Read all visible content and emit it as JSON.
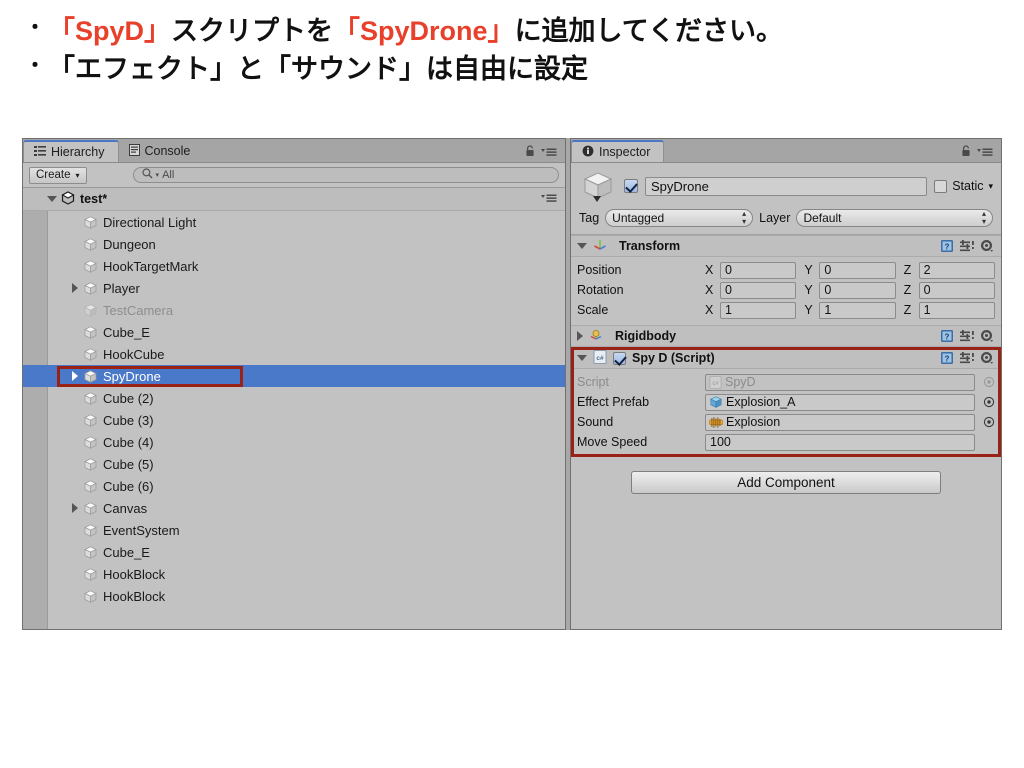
{
  "slide": {
    "bullets": [
      {
        "dot": "・",
        "segments": [
          {
            "text": "「SpyD」",
            "highlight": true
          },
          {
            "text": "スクリプトを",
            "highlight": false
          },
          {
            "text": "「SpyDrone」",
            "highlight": true
          },
          {
            "text": "に追加してください。",
            "highlight": false
          }
        ]
      },
      {
        "dot": "・",
        "segments": [
          {
            "text": "「エフェクト」と「サウンド」は自由に設定",
            "highlight": false
          }
        ]
      }
    ]
  },
  "colors": {
    "highlight_red": "#e8402a",
    "outline_red": "#9a2116",
    "selection_blue": "#4b79c9",
    "tab_accent": "#4b77c4",
    "panel_bg": "#c2c2c2"
  },
  "hierarchy": {
    "tabs": [
      {
        "label": "Hierarchy",
        "icon": "hierarchy-icon",
        "active": true
      },
      {
        "label": "Console",
        "icon": "console-icon",
        "active": false
      }
    ],
    "lock_icon": "lock-icon",
    "menu_icon": "panel-menu-icon",
    "toolbar": {
      "create_label": "Create",
      "create_arrow": "▾",
      "search_placeholder": "All",
      "search_value": "",
      "search_icon": "search-icon"
    },
    "scene": {
      "name": "test*",
      "icon": "unity-scene-icon",
      "expanded": true
    },
    "items": [
      {
        "label": "Directional Light",
        "indent": 1,
        "expandable": false,
        "active": true,
        "selected": false
      },
      {
        "label": "Dungeon",
        "indent": 1,
        "expandable": false,
        "active": true,
        "selected": false
      },
      {
        "label": "HookTargetMark",
        "indent": 1,
        "expandable": false,
        "active": true,
        "selected": false
      },
      {
        "label": "Player",
        "indent": 1,
        "expandable": true,
        "active": true,
        "selected": false
      },
      {
        "label": "TestCamera",
        "indent": 1,
        "expandable": false,
        "active": false,
        "selected": false
      },
      {
        "label": "Cube_E",
        "indent": 1,
        "expandable": false,
        "active": true,
        "selected": false
      },
      {
        "label": "HookCube",
        "indent": 1,
        "expandable": false,
        "active": true,
        "selected": false
      },
      {
        "label": "SpyDrone",
        "indent": 1,
        "expandable": true,
        "active": true,
        "selected": true
      },
      {
        "label": "Cube (2)",
        "indent": 1,
        "expandable": false,
        "active": true,
        "selected": false
      },
      {
        "label": "Cube (3)",
        "indent": 1,
        "expandable": false,
        "active": true,
        "selected": false
      },
      {
        "label": "Cube (4)",
        "indent": 1,
        "expandable": false,
        "active": true,
        "selected": false
      },
      {
        "label": "Cube (5)",
        "indent": 1,
        "expandable": false,
        "active": true,
        "selected": false
      },
      {
        "label": "Cube (6)",
        "indent": 1,
        "expandable": false,
        "active": true,
        "selected": false
      },
      {
        "label": "Canvas",
        "indent": 1,
        "expandable": true,
        "active": true,
        "selected": false
      },
      {
        "label": "EventSystem",
        "indent": 1,
        "expandable": false,
        "active": true,
        "selected": false
      },
      {
        "label": "Cube_E",
        "indent": 1,
        "expandable": false,
        "active": true,
        "selected": false
      },
      {
        "label": "HookBlock",
        "indent": 1,
        "expandable": false,
        "active": true,
        "selected": false
      },
      {
        "label": "HookBlock",
        "indent": 1,
        "expandable": false,
        "active": true,
        "selected": false
      }
    ]
  },
  "inspector": {
    "tab": {
      "label": "Inspector",
      "icon": "info-icon"
    },
    "lock_icon": "lock-icon",
    "menu_icon": "panel-menu-icon",
    "object": {
      "enabled": true,
      "name": "SpyDrone",
      "static_label": "Static",
      "static_checked": false,
      "static_arrow": "▾",
      "tag_label": "Tag",
      "tag_value": "Untagged",
      "layer_label": "Layer",
      "layer_value": "Default",
      "preview_icon": "gameobject-cube-icon"
    },
    "components": [
      {
        "name": "Transform",
        "icon": "transform-icon",
        "expanded": true,
        "has_checkbox": false,
        "help_icon": "help-book-icon",
        "preset_icon": "preset-icon",
        "gear_icon": "gear-icon",
        "vector_rows": [
          {
            "label": "Position",
            "x": "0",
            "y": "0",
            "z": "2"
          },
          {
            "label": "Rotation",
            "x": "0",
            "y": "0",
            "z": "0"
          },
          {
            "label": "Scale",
            "x": "1",
            "y": "1",
            "z": "1"
          }
        ],
        "axis_labels": [
          "X",
          "Y",
          "Z"
        ]
      },
      {
        "name": "Rigidbody",
        "icon": "rigidbody-icon",
        "expanded": false,
        "has_checkbox": false,
        "help_icon": "help-book-icon",
        "preset_icon": "preset-icon",
        "gear_icon": "gear-icon"
      }
    ],
    "script_component": {
      "name": "Spy D (Script)",
      "icon": "csharp-script-icon",
      "expanded": true,
      "enabled": true,
      "help_icon": "help-book-icon",
      "preset_icon": "preset-icon",
      "gear_icon": "gear-icon",
      "highlighted": true,
      "fields": [
        {
          "label": "Script",
          "value": "SpyD",
          "icon": "csharp-script-icon",
          "type": "object",
          "disabled": true,
          "picker": true
        },
        {
          "label": "Effect Prefab",
          "value": "Explosion_A",
          "icon": "prefab-cube-icon",
          "type": "object",
          "disabled": false,
          "picker": true
        },
        {
          "label": "Sound",
          "value": "Explosion",
          "icon": "audioclip-icon",
          "type": "object",
          "disabled": false,
          "picker": true
        },
        {
          "label": "Move Speed",
          "value": "100",
          "icon": "",
          "type": "number",
          "disabled": false,
          "picker": false
        }
      ]
    },
    "add_component_label": "Add Component"
  }
}
